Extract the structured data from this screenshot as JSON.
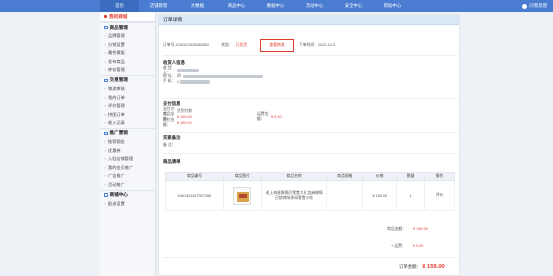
{
  "topnav": {
    "items": [
      "首页",
      "店铺管理",
      "大数据",
      "商品中心",
      "数据中心",
      "活动中心",
      "安全中心",
      "帮助中心"
    ],
    "user_label": "问卷反馈"
  },
  "sidebar": {
    "shop_title": "我的商城",
    "groups": [
      {
        "title": "商品管理",
        "items": [
          "品牌管理",
          "分销设置",
          "属性模版",
          "发布商品",
          "库存管理"
        ]
      },
      {
        "title": "交易管理",
        "items": [
          "物流审核",
          "我的订单",
          "评价管理",
          "拼团订单",
          "收入记录"
        ]
      },
      {
        "title": "推广营销",
        "items": [
          "推荐佣金",
          "优惠券",
          "入驻店铺管理",
          "我的金贝推广",
          "广告推广",
          "活动推广"
        ]
      },
      {
        "title": "商铺中心",
        "items": [
          "配送设置"
        ]
      }
    ]
  },
  "panel": {
    "title": "订单详情"
  },
  "order": {
    "number_label": "订单号:4782221526382552",
    "status_label": "状态：",
    "status_value": "已发货",
    "detail_button": "查看物流",
    "time_label": "下单时间：2022-12-3"
  },
  "receiver": {
    "title": "收货人信息",
    "rows": [
      {
        "k": "收 货 人：",
        "v": ""
      },
      {
        "k": "地    址：",
        "v": "四"
      },
      {
        "k": "手    机：",
        "v": "1"
      }
    ]
  },
  "payment": {
    "title": "支付信息",
    "rows": [
      {
        "k": "支付方式：",
        "v": "货到付款"
      },
      {
        "k": "商品金额：",
        "v": "¥ 159.00",
        "k2": "运费金额：",
        "v2": "¥ 0.00"
      },
      {
        "k": "应付金额：",
        "v": "¥ 159.00"
      }
    ]
  },
  "remark": {
    "title": "买家备注",
    "row_k": "备    注：",
    "row_v": ""
  },
  "goods": {
    "title": "商品清单",
    "headers": [
      "商品编号",
      "商品图片",
      "商品名称",
      "商品规格",
      "价格",
      "数量",
      "操作"
    ],
    "rows": [
      {
        "id": "6461461167957286",
        "name": "老上海香酥锅巴零食大礼包麻辣锅巴烧烤味休闲零食小吃",
        "spec": "",
        "price": "¥ 159.00",
        "qty": "1",
        "op": "评价"
      }
    ]
  },
  "summary": {
    "goods_label": "商品金额：",
    "goods_value": "¥ 159.00",
    "shipping_label": "+ 运费：",
    "shipping_value": "¥ 0.00",
    "total_label": "订单金额：",
    "total_value": "¥ 159.00"
  }
}
